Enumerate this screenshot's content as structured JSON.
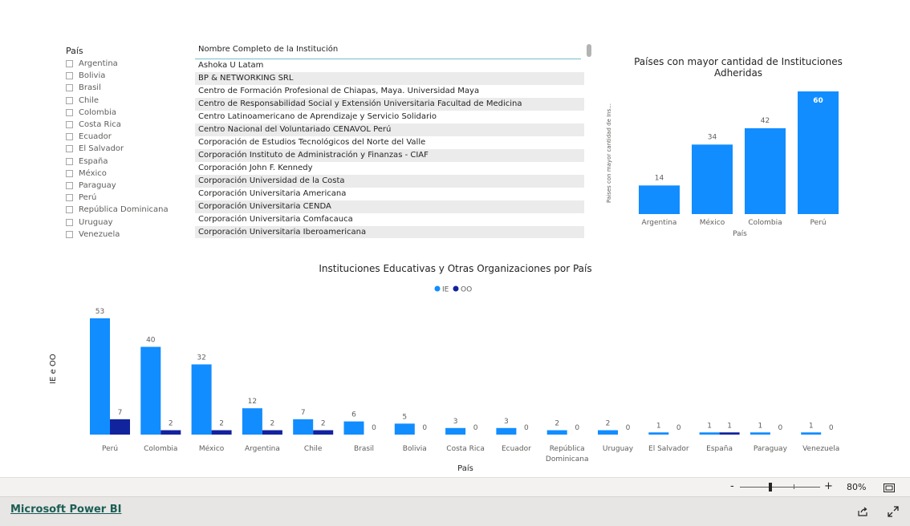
{
  "slicer": {
    "title": "País",
    "items": [
      "Argentina",
      "Bolivia",
      "Brasil",
      "Chile",
      "Colombia",
      "Costa Rica",
      "Ecuador",
      "El Salvador",
      "España",
      "México",
      "Paraguay",
      "Perú",
      "República Dominicana",
      "Uruguay",
      "Venezuela"
    ]
  },
  "table": {
    "header": "Nombre Completo de la Institución",
    "rows": [
      "Ashoka U Latam",
      "BP & NETWORKING SRL",
      "Centro de Formación Profesional de Chiapas, Maya. Universidad Maya",
      "Centro de Responsabilidad Social y Extensión Universitaria Facultad de Medicina",
      "Centro Latinoamericano de Aprendizaje y Servicio Solidario",
      "Centro Nacional del Voluntariado CENAVOL Perú",
      "Corporación de Estudios Tecnológicos del Norte del Valle",
      "Corporación Instituto de Administración y Finanzas - CIAF",
      "Corporación John F. Kennedy",
      "Corporación Universidad de la Costa",
      "Corporación Universitaria Americana",
      "Corporación Universitaria CENDA",
      "Corporación Universitaria Comfacauca",
      "Corporación Universitaria Iberoamericana"
    ]
  },
  "top_chart": {
    "title_line1": "Países con mayor cantidad de Instituciones",
    "title_line2": "Adheridas"
  },
  "bottom_chart": {
    "title": "Instituciones Educativas y Otras Organizaciones por País"
  },
  "zoom": {
    "minus": "-",
    "plus": "+",
    "level": "80%"
  },
  "footer": {
    "link": "Microsoft Power BI"
  },
  "colors": {
    "ie": "#118dff",
    "oo": "#12239e"
  },
  "chart_data": [
    {
      "type": "bar",
      "title": "Países con mayor cantidad de Instituciones Adheridas",
      "xlabel": "País",
      "ylabel": "Paises con mayor cantidad de Ins...",
      "categories": [
        "Argentina",
        "México",
        "Colombia",
        "Perú"
      ],
      "values": [
        14,
        34,
        42,
        60
      ],
      "ylim": [
        0,
        60
      ],
      "grid": false
    },
    {
      "type": "bar",
      "title": "Instituciones Educativas y Otras Organizaciones por País",
      "xlabel": "País",
      "ylabel": "IE e OO",
      "legend_position": "top-center",
      "categories": [
        "Perú",
        "Colombia",
        "México",
        "Argentina",
        "Chile",
        "Brasil",
        "Bolivia",
        "Costa Rica",
        "Ecuador",
        "República Dominicana",
        "Uruguay",
        "El Salvador",
        "España",
        "Paraguay",
        "Venezuela"
      ],
      "series": [
        {
          "name": "IE",
          "values": [
            53,
            40,
            32,
            12,
            7,
            6,
            5,
            3,
            3,
            2,
            2,
            1,
            1,
            1,
            1
          ]
        },
        {
          "name": "OO",
          "values": [
            7,
            2,
            2,
            2,
            2,
            0,
            0,
            0,
            0,
            0,
            0,
            0,
            1,
            0,
            0
          ]
        }
      ],
      "ylim": [
        0,
        53
      ],
      "grid": false
    }
  ]
}
